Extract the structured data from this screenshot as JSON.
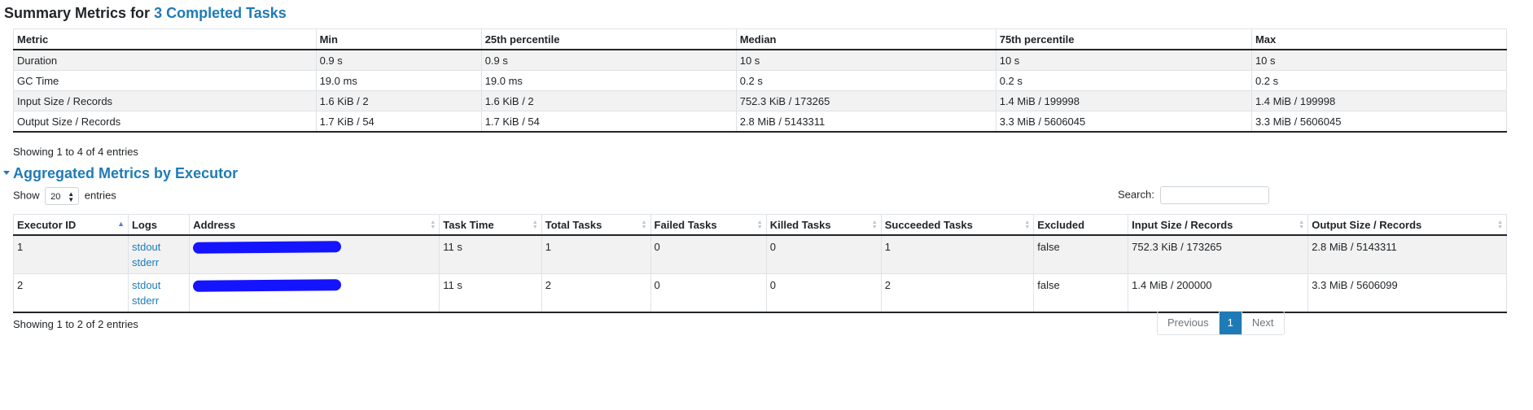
{
  "summary": {
    "title_prefix": "Summary Metrics for",
    "title_link": "3 Completed Tasks",
    "columns": [
      "Metric",
      "Min",
      "25th percentile",
      "Median",
      "75th percentile",
      "Max"
    ],
    "rows": [
      [
        "Duration",
        "0.9 s",
        "0.9 s",
        "10 s",
        "10 s",
        "10 s"
      ],
      [
        "GC Time",
        "19.0 ms",
        "19.0 ms",
        "0.2 s",
        "0.2 s",
        "0.2 s"
      ],
      [
        "Input Size / Records",
        "1.6 KiB / 2",
        "1.6 KiB / 2",
        "752.3 KiB / 173265",
        "1.4 MiB / 199998",
        "1.4 MiB / 199998"
      ],
      [
        "Output Size / Records",
        "1.7 KiB / 54",
        "1.7 KiB / 54",
        "2.8 MiB / 5143311",
        "3.3 MiB / 5606045",
        "3.3 MiB / 5606045"
      ]
    ],
    "info": "Showing 1 to 4 of 4 entries"
  },
  "executors": {
    "title": "Aggregated Metrics by Executor",
    "show_label": "Show",
    "show_value": "20",
    "entries_label": "entries",
    "search_label": "Search:",
    "search_value": "",
    "columns": [
      "Executor ID",
      "Logs",
      "Address",
      "Task Time",
      "Total Tasks",
      "Failed Tasks",
      "Killed Tasks",
      "Succeeded Tasks",
      "Excluded",
      "Input Size / Records",
      "Output Size / Records"
    ],
    "rows": [
      {
        "id": "1",
        "log1": "stdout",
        "log2": "stderr",
        "task_time": "11 s",
        "total": "1",
        "failed": "0",
        "killed": "0",
        "succeeded": "1",
        "excluded": "false",
        "input": "752.3 KiB / 173265",
        "output": "2.8 MiB / 5143311"
      },
      {
        "id": "2",
        "log1": "stdout",
        "log2": "stderr",
        "task_time": "11 s",
        "total": "2",
        "failed": "0",
        "killed": "0",
        "succeeded": "2",
        "excluded": "false",
        "input": "1.4 MiB / 200000",
        "output": "3.3 MiB / 5606099"
      }
    ],
    "info": "Showing 1 to 2 of 2 entries",
    "pager": {
      "previous": "Previous",
      "current": "1",
      "next": "Next"
    }
  },
  "colors": {
    "link": "#1f7bb6",
    "redaction": "#1414ff",
    "stripe": "#f2f2f2"
  }
}
